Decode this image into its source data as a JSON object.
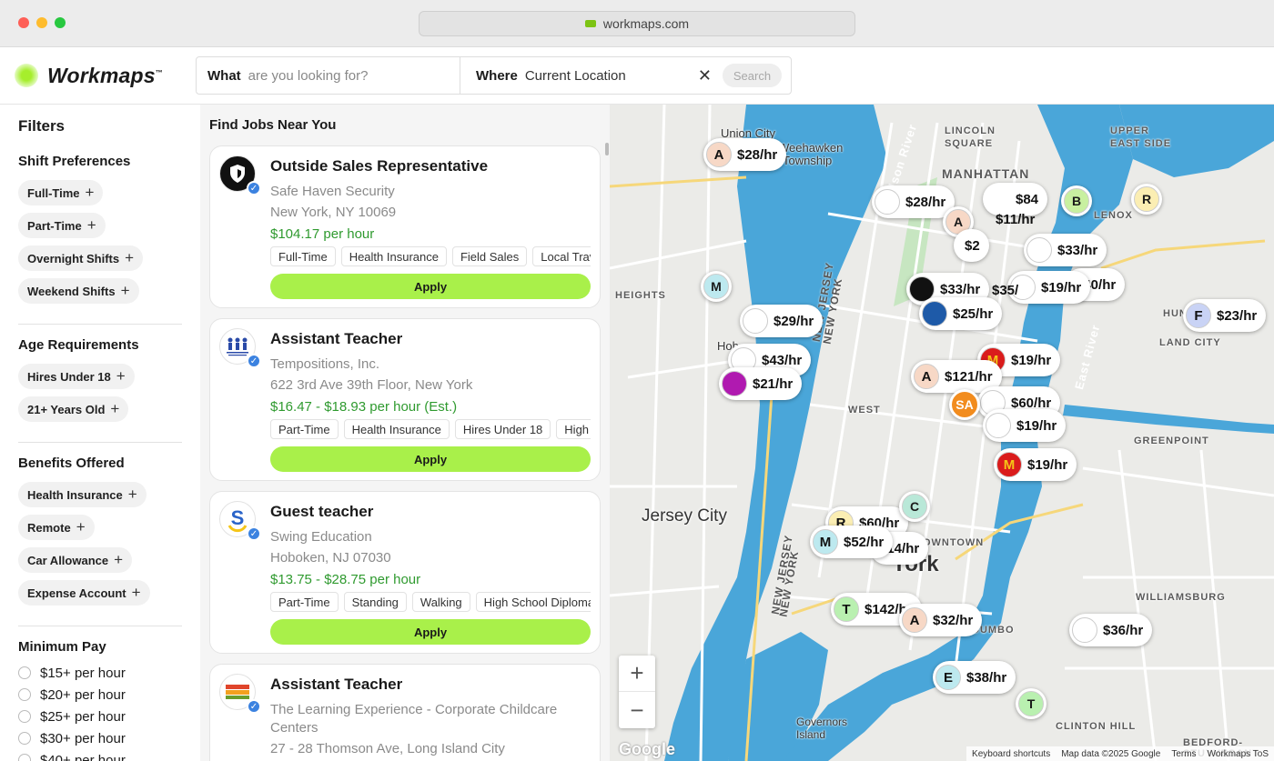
{
  "browser": {
    "url": "workmaps.com"
  },
  "header": {
    "logo": "Workmaps",
    "logo_tm": "™",
    "what_label": "What",
    "what_placeholder": "are you looking for?",
    "where_label": "Where",
    "where_value": "Current Location",
    "clear_icon": "close-icon",
    "search_label": "Search"
  },
  "filters": {
    "title": "Filters",
    "shift": {
      "title": "Shift Preferences",
      "chips": [
        "Full-Time",
        "Part-Time",
        "Overnight Shifts",
        "Weekend Shifts"
      ]
    },
    "age": {
      "title": "Age Requirements",
      "chips": [
        "Hires Under 18",
        "21+ Years Old"
      ]
    },
    "benefits": {
      "title": "Benefits Offered",
      "chips": [
        "Health Insurance",
        "Remote",
        "Car Allowance",
        "Expense Account"
      ]
    },
    "pay": {
      "title": "Minimum Pay",
      "options": [
        "$15+ per hour",
        "$20+ per hour",
        "$25+ per hour",
        "$30+ per hour",
        "$40+ per hour"
      ]
    }
  },
  "list": {
    "title": "Find Jobs Near You",
    "apply_label": "Apply",
    "jobs": [
      {
        "title": "Outside Sales Representative",
        "company": "Safe Haven Security",
        "location": "New York, NY 10069",
        "pay": "$104.17 per hour",
        "tags": [
          "Full-Time",
          "Health Insurance",
          "Field Sales",
          "Local Travel"
        ]
      },
      {
        "title": "Assistant Teacher",
        "company": "Tempositions, Inc.",
        "location": "622 3rd Ave 39th Floor, New York",
        "pay": "$16.47 - $18.93 per hour (Est.)",
        "tags": [
          "Part-Time",
          "Health Insurance",
          "Hires Under 18",
          "High School Diploma"
        ]
      },
      {
        "title": "Guest teacher",
        "company": "Swing Education",
        "location": "Hoboken, NJ 07030",
        "pay": "$13.75 - $28.75 per hour",
        "tags": [
          "Part-Time",
          "Standing",
          "Walking",
          "High School Diploma"
        ]
      },
      {
        "title": "Assistant Teacher",
        "company": "The Learning Experience - Corporate Childcare Centers",
        "location": "27 - 28 Thomson Ave, Long Island City"
      }
    ]
  },
  "map": {
    "labels": {
      "union_city": "Union City",
      "weehawken": "Weehawken",
      "township": "Township",
      "manhattan": "MANHATTAN",
      "lincoln_square": "LINCOLN\nSQUARE",
      "upper_east_side": "UPPER\nEAST SIDE",
      "lenox": "LENOX",
      "heights": "HEIGHTS",
      "hoboken": "Hob",
      "west": "WEST",
      "jersey_city": "Jersey City",
      "new_york": "York",
      "greenpoint": "GREENPOINT",
      "williamsburg": "WILLIAMSBURG",
      "clinton_hill": "CLINTON HILL",
      "bedford": "BEDFORD-STUYVESANT",
      "governors_island": "Governors\nIsland",
      "downtown": "DOWNTOWN",
      "hunters": "HUN",
      "island_city": "LAND CITY",
      "dumbo": "DUMBO",
      "hudson_river": "Hudson River",
      "east_river": "East River",
      "new_jersey": "NEW JERSEY",
      "new_york_state": "NEW YORK"
    },
    "pins": [
      {
        "letter": "A",
        "rate": "$28/hr",
        "color": "#f7d8c6"
      },
      {
        "letter": "",
        "rate": "$28/hr",
        "color": "#fff"
      },
      {
        "letter": "",
        "rate": "$84",
        "color": "#fff"
      },
      {
        "letter": "",
        "rate": "$33/hr",
        "color": "#fff"
      },
      {
        "letter": "",
        "rate": "$40/hr",
        "color": "#fff"
      },
      {
        "letter": "",
        "rate": "$33/hr",
        "color": "#111"
      },
      {
        "letter": "",
        "rate": "$19/hr",
        "color": "#fff"
      },
      {
        "letter": "",
        "rate": "$29/hr",
        "color": "#fff"
      },
      {
        "letter": "",
        "rate": "$25/hr",
        "color": "#1e5aa8"
      },
      {
        "letter": "F",
        "rate": "$23/hr",
        "color": "#c9d3f5"
      },
      {
        "letter": "",
        "rate": "$43/hr",
        "color": "#fff"
      },
      {
        "letter": "",
        "rate": "$21/hr",
        "color": "#b01ab0"
      },
      {
        "letter": "",
        "rate": "$19/hr",
        "color": "#da1c1c"
      },
      {
        "letter": "A",
        "rate": "$121/hr",
        "color": "#f7d8c6"
      },
      {
        "letter": "",
        "rate": "$60/hr",
        "color": "#fff"
      },
      {
        "letter": "",
        "rate": "$19/hr",
        "color": "#fff"
      },
      {
        "letter": "",
        "rate": "$19/hr",
        "color": "#da1c1c"
      },
      {
        "letter": "R",
        "rate": "$60/hr",
        "color": "#fbeeb3"
      },
      {
        "letter": "M",
        "rate": "$52/hr",
        "color": "#bde9ef"
      },
      {
        "letter": "",
        "rate": "$14/hr",
        "color": "#fff"
      },
      {
        "letter": "T",
        "rate": "$142/hr",
        "color": "#b9f0b0"
      },
      {
        "letter": "A",
        "rate": "$32/hr",
        "color": "#f7d8c6"
      },
      {
        "letter": "",
        "rate": "$36/hr",
        "color": "#fff"
      },
      {
        "letter": "E",
        "rate": "$38/hr",
        "color": "#bde9ef"
      },
      {
        "letter": "",
        "rate": "$35/",
        "color": "#fff"
      },
      {
        "letter": "",
        "rate": "$11/hr",
        "color": "#fff"
      },
      {
        "letter": "",
        "rate": "$2",
        "color": "#fff"
      }
    ],
    "bubbles": [
      "B",
      "R",
      "M",
      "C",
      "T",
      "A",
      "SA"
    ],
    "attribution": [
      "Keyboard shortcuts",
      "Map data ©2025 Google",
      "Terms",
      "Workmaps ToS"
    ],
    "google": "Google"
  }
}
